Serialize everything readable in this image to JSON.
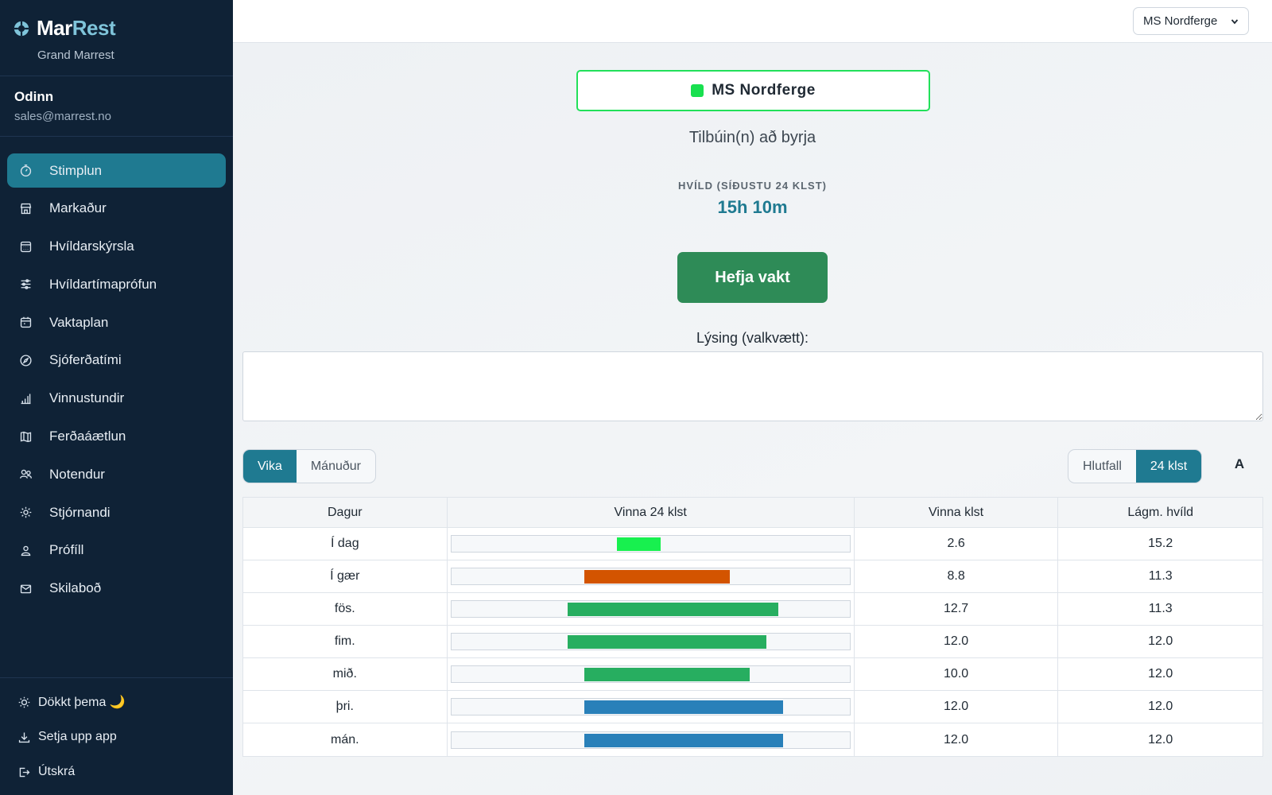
{
  "brand": {
    "name_a": "Mar",
    "name_b": "Rest",
    "subtitle": "Grand Marrest"
  },
  "user": {
    "name": "Odinn",
    "email": "sales@marrest.no"
  },
  "sidebar": {
    "items": [
      {
        "label": "Stimplun",
        "icon": "stopwatch-icon",
        "active": true
      },
      {
        "label": "Markaður",
        "icon": "store-icon",
        "active": false
      },
      {
        "label": "Hvíldarskýrsla",
        "icon": "calendar-grid-icon",
        "active": false
      },
      {
        "label": "Hvíldartímaprófun",
        "icon": "sliders-icon",
        "active": false
      },
      {
        "label": "Vaktaplan",
        "icon": "calendar-icon",
        "active": false
      },
      {
        "label": "Sjóferðatími",
        "icon": "compass-icon",
        "active": false
      },
      {
        "label": "Vinnustundir",
        "icon": "bar-chart-icon",
        "active": false
      },
      {
        "label": "Ferðaáætlun",
        "icon": "map-icon",
        "active": false
      },
      {
        "label": "Notendur",
        "icon": "users-icon",
        "active": false
      },
      {
        "label": "Stjórnandi",
        "icon": "gear-icon",
        "active": false
      },
      {
        "label": "Prófíll",
        "icon": "user-icon",
        "active": false
      },
      {
        "label": "Skilaboð",
        "icon": "envelope-icon",
        "active": false
      }
    ],
    "bottom": [
      {
        "label": "Dökkt þema 🌙",
        "icon": "sun-icon"
      },
      {
        "label": "Setja upp app",
        "icon": "download-icon"
      },
      {
        "label": "Útskrá",
        "icon": "logout-icon"
      }
    ]
  },
  "topbar": {
    "vessel_select": "MS Nordferge"
  },
  "main": {
    "vessel_name": "MS Nordferge",
    "vessel_status_color": "#18e04f",
    "status_text": "Tilbúin(n) að byrja",
    "rest_label": "HVÍLD (SÍÐUSTU 24 KLST)",
    "rest_value": "15h 10m",
    "start_button": "Hefja vakt",
    "description_label": "Lýsing (valkvætt):",
    "description_value": "",
    "period_tabs": [
      {
        "label": "Vika",
        "active": true
      },
      {
        "label": "Mánuður",
        "active": false
      }
    ],
    "mode_tabs": [
      {
        "label": "Hlutfall",
        "active": false
      },
      {
        "label": "24 klst",
        "active": true
      }
    ],
    "font_toggle": "A"
  },
  "table": {
    "headers": [
      "Dagur",
      "Vinna 24 klst",
      "Vinna klst",
      "Lágm. hvíld"
    ],
    "rows": [
      {
        "day": "Í dag",
        "work_start_h": 10.0,
        "work_end_h": 12.6,
        "work": "2.6",
        "min_rest": "15.2",
        "color": "#18f04f"
      },
      {
        "day": "Í gær",
        "work_start_h": 8.0,
        "work_end_h": 16.8,
        "work": "8.8",
        "min_rest": "11.3",
        "color": "#d35400"
      },
      {
        "day": "fös.",
        "work_start_h": 7.0,
        "work_end_h": 19.7,
        "work": "12.7",
        "min_rest": "11.3",
        "color": "#27ae60"
      },
      {
        "day": "fim.",
        "work_start_h": 7.0,
        "work_end_h": 19.0,
        "work": "12.0",
        "min_rest": "12.0",
        "color": "#27ae60"
      },
      {
        "day": "mið.",
        "work_start_h": 8.0,
        "work_end_h": 18.0,
        "work": "10.0",
        "min_rest": "12.0",
        "color": "#27ae60"
      },
      {
        "day": "þri.",
        "work_start_h": 8.0,
        "work_end_h": 20.0,
        "work": "12.0",
        "min_rest": "12.0",
        "color": "#2980b9"
      },
      {
        "day": "mán.",
        "work_start_h": 8.0,
        "work_end_h": 20.0,
        "work": "12.0",
        "min_rest": "12.0",
        "color": "#2980b9"
      }
    ]
  }
}
